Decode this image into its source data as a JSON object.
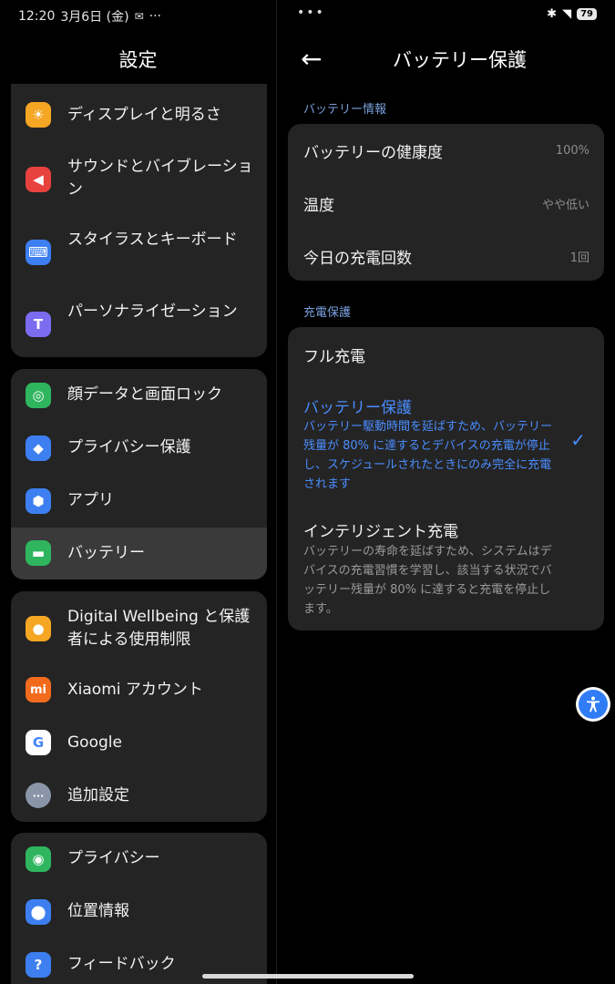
{
  "status": {
    "time": "12:20",
    "date": "3月6日 (金)",
    "more": "···",
    "dots": "•••",
    "battery": "79"
  },
  "left": {
    "title": "設定",
    "items": [
      {
        "label": "ディスプレイと明るさ",
        "icon": "brightness-icon",
        "glyph": "☀",
        "color": "#f5a623"
      },
      {
        "label": "サウンドとバイブレーション",
        "icon": "sound-icon",
        "glyph": "🔊",
        "color": "#e8423f"
      },
      {
        "label": "スタイラスとキーボード",
        "icon": "keyboard-icon",
        "glyph": "⌨",
        "color": "#3d7ff0"
      },
      {
        "label": "パーソナライゼーション",
        "icon": "personalization-icon",
        "glyph": "T",
        "color": "#7b6cf0"
      },
      {
        "label": "顔データと画面ロック",
        "icon": "fingerprint-icon",
        "glyph": "◎",
        "color": "#2fb55e"
      },
      {
        "label": "プライバシー保護",
        "icon": "privacy-shield-icon",
        "glyph": "◆",
        "color": "#3d7ff0"
      },
      {
        "label": "アプリ",
        "icon": "apps-icon",
        "glyph": "⬢",
        "color": "#3d7ff0"
      },
      {
        "label": "バッテリー",
        "icon": "battery-icon",
        "glyph": "▬",
        "color": "#2fb55e"
      },
      {
        "label": "Digital Wellbeing と保護者による使用制限",
        "icon": "wellbeing-icon",
        "glyph": "●",
        "color": "#f5a623"
      },
      {
        "label": "Xiaomi アカウント",
        "icon": "xiaomi-icon",
        "glyph": "mi",
        "color": "#f26b1d"
      },
      {
        "label": "Google",
        "icon": "google-icon",
        "glyph": "G",
        "color": "#ffffff"
      },
      {
        "label": "追加設定",
        "icon": "more-settings-icon",
        "glyph": "···",
        "color": "#8a96a8"
      },
      {
        "label": "プライバシー",
        "icon": "eye-icon",
        "glyph": "◉",
        "color": "#2fb55e"
      },
      {
        "label": "位置情報",
        "icon": "location-icon",
        "glyph": "⬤",
        "color": "#3d7ff0"
      },
      {
        "label": "フィードバック",
        "icon": "feedback-icon",
        "glyph": "?",
        "color": "#3d7ff0"
      }
    ]
  },
  "right": {
    "back": "←",
    "title": "バッテリー保護",
    "info_section": "バッテリー情報",
    "info_rows": [
      {
        "label": "バッテリーの健康度",
        "value": "100%"
      },
      {
        "label": "温度",
        "value": "やや低い"
      },
      {
        "label": "今日の充電回数",
        "value": "1回"
      }
    ],
    "charge_section": "充電保護",
    "options": [
      {
        "title": "フル充電",
        "desc": ""
      },
      {
        "title": "バッテリー保護",
        "desc": "バッテリー駆動時間を延ばすため、バッテリー残量が 80% に達するとデバイスの充電が停止し、スケジュールされたときにのみ完全に充電されます",
        "selected": true
      },
      {
        "title": "インテリジェント充電",
        "desc": "バッテリーの寿命を延ばすため、システムはデバイスの充電習慣を学習し、該当する状況でバッテリー残量が 80% に達すると充電を停止します。"
      }
    ],
    "check": "✓"
  }
}
